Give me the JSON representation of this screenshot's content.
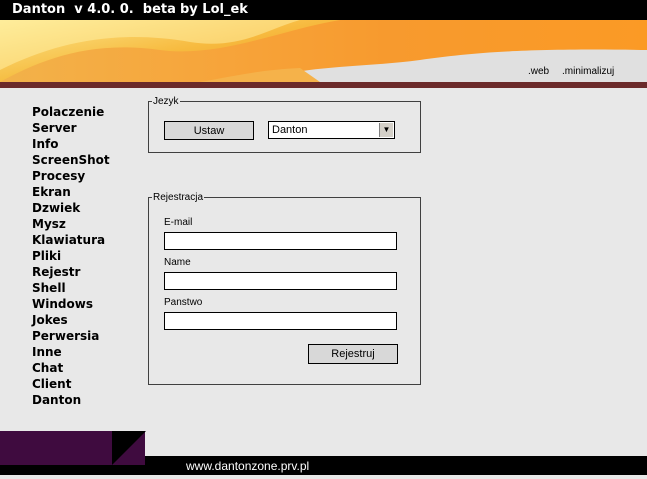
{
  "title": {
    "app": "Danton  v 4.0. 0.  beta",
    "author": "by Lol_ek"
  },
  "top_links": {
    "web": ".web",
    "minimize": ".minimalizuj"
  },
  "nav": [
    "Polaczenie",
    "Server",
    "Info",
    "ScreenShot",
    "Procesy",
    "Ekran",
    "Dzwiek",
    "Mysz",
    "Klawiatura",
    "Pliki",
    "Rejestr",
    "Shell",
    "Windows",
    "Jokes",
    "Perwersia",
    "Inne",
    "Chat",
    "Client",
    "Danton"
  ],
  "language": {
    "legend": "Jezyk",
    "set_button": "Ustaw",
    "selected": "Danton"
  },
  "registration": {
    "legend": "Rejestracja",
    "email_label": "E-mail",
    "email_value": "",
    "name_label": "Name",
    "name_value": "",
    "country_label": "Panstwo",
    "country_value": "",
    "register_button": "Rejestruj"
  },
  "footer": {
    "url": "www.dantonzone.prv.pl"
  },
  "colors": {
    "banner": "#f7a43a",
    "strip": "#6b2a2a",
    "footer": "#3f0b3f"
  }
}
